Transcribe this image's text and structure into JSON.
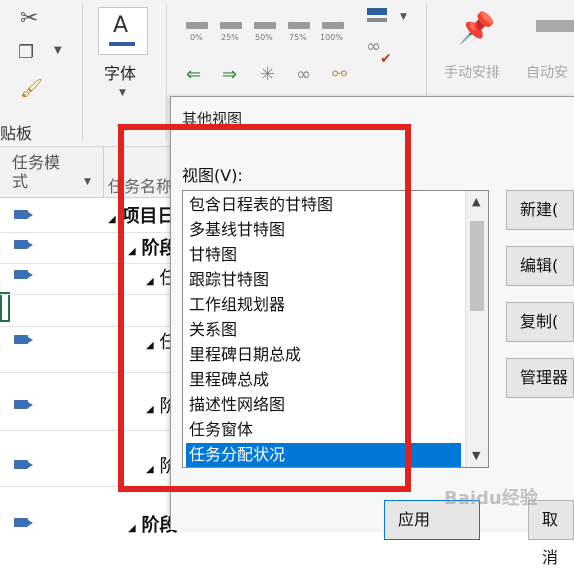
{
  "ribbon": {
    "font_label": "字体",
    "clipboard_label": "贴板",
    "zoom_labels": [
      "0%",
      "25%",
      "50%",
      "75%",
      "100%"
    ],
    "manual_schedule": "手动安排",
    "auto_schedule": "自动安"
  },
  "grid": {
    "col_mode_header": "任务模式",
    "col_name_header": "任务名称",
    "rows": [
      {
        "marker": "◢",
        "text": "项目日"
      },
      {
        "marker": "◢",
        "text": "阶段"
      },
      {
        "marker": "◢",
        "text": "任"
      },
      {
        "marker": "",
        "text": ""
      },
      {
        "marker": "◢",
        "text": "任"
      },
      {
        "marker": "◢",
        "text": "阶"
      },
      {
        "marker": "◢",
        "text": "阶"
      },
      {
        "marker": "◢",
        "text": "阶段"
      }
    ]
  },
  "dialog": {
    "title": "其他视图",
    "list_label": "视图(V):",
    "views": [
      "包含日程表的甘特图",
      "多基线甘特图",
      "甘特图",
      "跟踪甘特图",
      "工作组规划器",
      "关系图",
      "里程碑日期总成",
      "里程碑总成",
      "描述性网络图",
      "任务窗体",
      "任务分配状况"
    ],
    "selected_index": 10,
    "buttons": {
      "new": "新建(",
      "edit": "编辑(",
      "copy": "复制(",
      "organizer": "管理器",
      "apply": "应用",
      "cancel": "取消"
    }
  },
  "watermark": "Baidu经验",
  "colors": {
    "selection": "#0078d7",
    "highlight_box": "#e3221f"
  }
}
